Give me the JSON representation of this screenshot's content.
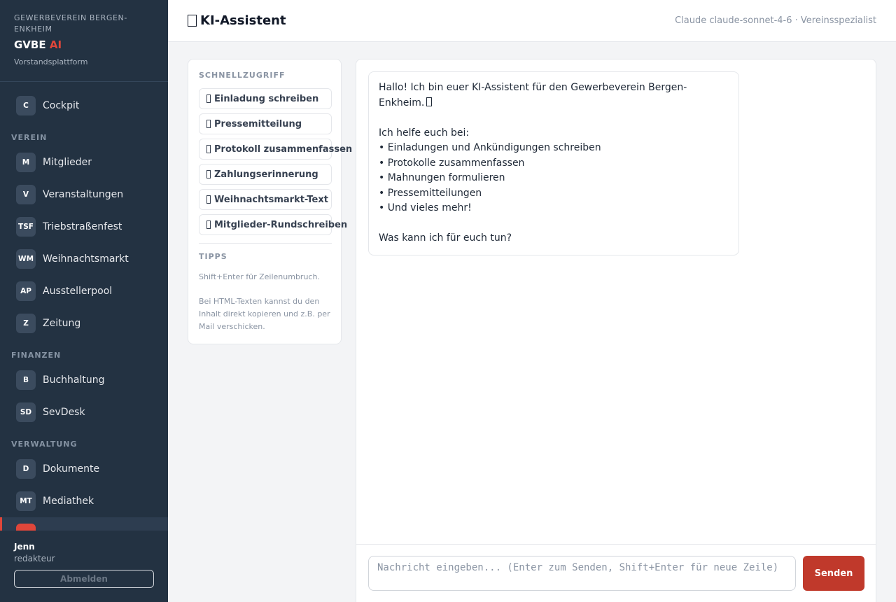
{
  "brand": {
    "org": "GEWERBEVEREIN BERGEN-ENKHEIM",
    "name": "GVBE",
    "name_accent": "AI",
    "subtitle": "Vorstandsplattform"
  },
  "nav": {
    "cockpit": {
      "badge": "C",
      "label": "Cockpit"
    },
    "sections": {
      "verein": "VEREIN",
      "finanzen": "FINANZEN",
      "verwaltung": "VERWALTUNG"
    },
    "verein_items": [
      {
        "badge": "M",
        "label": "Mitglieder"
      },
      {
        "badge": "V",
        "label": "Veranstaltungen"
      },
      {
        "badge": "TSF",
        "label": "Triebstraßenfest"
      },
      {
        "badge": "WM",
        "label": "Weihnachtsmarkt"
      },
      {
        "badge": "AP",
        "label": "Ausstellerpool"
      },
      {
        "badge": "Z",
        "label": "Zeitung"
      }
    ],
    "finanzen_items": [
      {
        "badge": "B",
        "label": "Buchhaltung"
      },
      {
        "badge": "SD",
        "label": "SevDesk"
      }
    ],
    "verwaltung_items": [
      {
        "badge": "D",
        "label": "Dokumente"
      },
      {
        "badge": "MT",
        "label": "Mediathek"
      }
    ]
  },
  "user": {
    "name": "Jenn",
    "role": "redakteur",
    "logout_label": "Abmelden"
  },
  "header": {
    "title": "KI-Assistent",
    "title_icon": "robot-emoji",
    "model_info": "Claude claude-sonnet-4-6 · Vereinsspezialist"
  },
  "quick": {
    "title": "SCHNELLZUGRIFF",
    "items": [
      "Einladung schreiben",
      "Pressemitteilung",
      "Protokoll zusammenfassen",
      "Zahlungserinnerung",
      "Weihnachtsmarkt-Text",
      "Mitglieder-Rundschreiben"
    ],
    "tips_title": "TIPPS",
    "tip_1": "Shift+Enter für Zeilenumbruch.",
    "tip_2": "Bei HTML-Texten kannst du den Inhalt direkt kopieren und z.B. per Mail verschicken."
  },
  "chat": {
    "greeting": "Hallo! Ich bin euer KI-Assistent für den Gewerbeverein Bergen-Enkheim.",
    "intro": "Ich helfe euch bei:",
    "bullets": [
      "• Einladungen und Ankündigungen schreiben",
      "• Protokolle zusammenfassen",
      "• Mahnungen formulieren",
      "• Pressemitteilungen",
      "• Und vieles mehr!"
    ],
    "closing": "Was kann ich für euch tun?",
    "input_placeholder": "Nachricht eingeben... (Enter zum Senden, Shift+Enter für neue Zeile)",
    "send_label": "Senden"
  },
  "colors": {
    "sidebar_bg": "#233242",
    "accent": "#e0463a",
    "send_button": "#c0392b"
  }
}
